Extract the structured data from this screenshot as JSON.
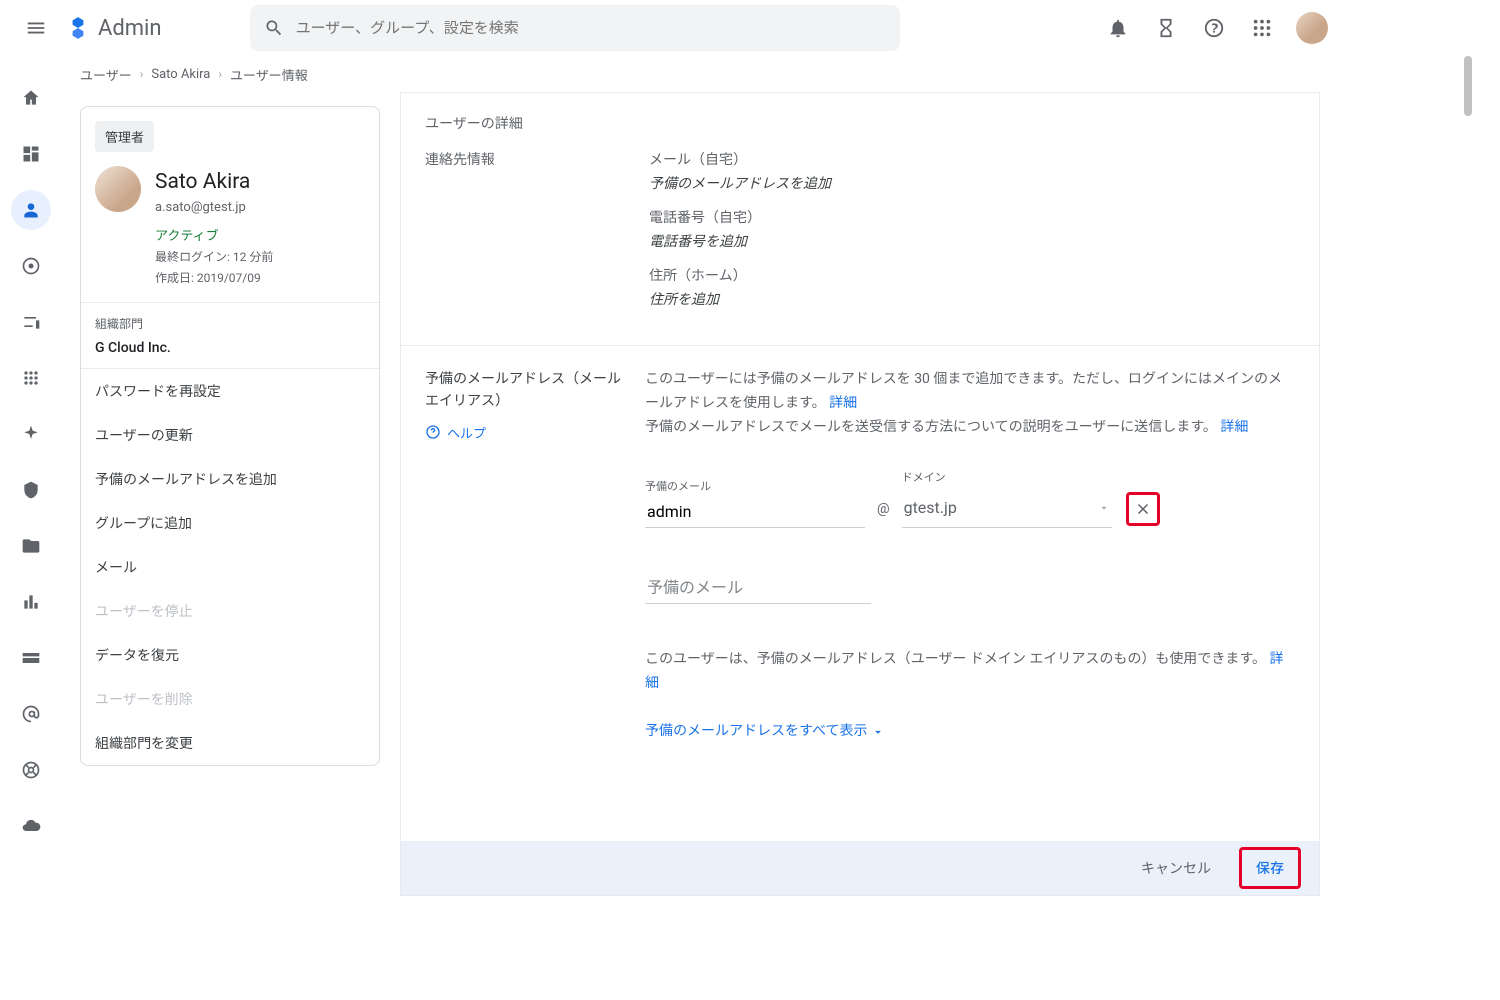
{
  "header": {
    "product": "Admin",
    "search_placeholder": "ユーザー、グループ、設定を検索"
  },
  "breadcrumbs": {
    "a": "ユーザー",
    "b": "Sato Akira",
    "c": "ユーザー情報"
  },
  "usercard": {
    "role_chip": "管理者",
    "name": "Sato Akira",
    "email": "a.sato@gtest.jp",
    "status": "アクティブ",
    "last_login": "最終ログイン: 12 分前",
    "created": "作成日: 2019/07/09",
    "org_label": "組織部門",
    "org_name": "G Cloud Inc.",
    "links": {
      "reset_pw": "パスワードを再設定",
      "update_user": "ユーザーの更新",
      "add_alias": "予備のメールアドレスを追加",
      "add_group": "グループに追加",
      "mail": "メール",
      "suspend": "ユーザーを停止",
      "restore": "データを復元",
      "delete": "ユーザーを削除",
      "change_org": "組織部門を変更"
    }
  },
  "details": {
    "section_title": "ユーザーの詳細",
    "contact_heading": "連絡先情報",
    "email_label": "メール（自宅）",
    "email_action": "予備のメールアドレスを追加",
    "phone_label": "電話番号（自宅）",
    "phone_action": "電話番号を追加",
    "addr_label": "住所（ホーム）",
    "addr_action": "住所を追加"
  },
  "alias": {
    "title": "予備のメールアドレス（メール エイリアス）",
    "help": "ヘルプ",
    "desc1a": "このユーザーには予備のメールアドレスを 30 個まで追加できます。ただし、ログインにはメインのメールアドレスを使用します。",
    "desc1_link": "詳細",
    "desc2a": "予備のメールアドレスでメールを送受信する方法についての説明をユーザーに送信します。",
    "desc2_link": "詳細",
    "field_alias_label": "予備のメール",
    "field_alias_value": "admin",
    "at": "@",
    "field_domain_label": "ドメイン",
    "field_domain_value": "gtest.jp",
    "field2_placeholder": "予備のメール",
    "note": "このユーザーは、予備のメールアドレス（ユーザー ドメイン エイリアスのもの）も使用できます。",
    "note_link": "詳細",
    "show_all": "予備のメールアドレスをすべて表示"
  },
  "footer": {
    "cancel": "キャンセル",
    "save": "保存"
  }
}
